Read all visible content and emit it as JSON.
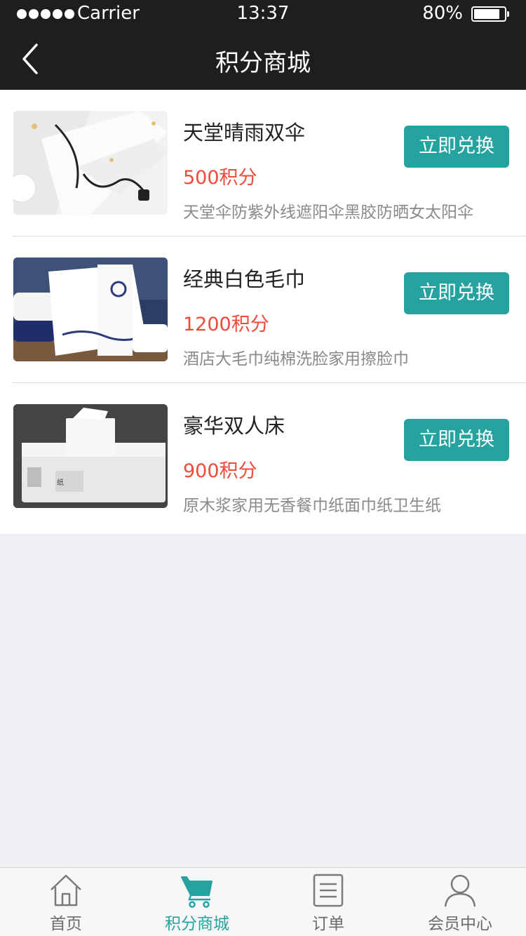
{
  "status_bar": {
    "carrier": "Carrier",
    "time": "13:37",
    "battery": "80%"
  },
  "nav": {
    "title": "积分商城",
    "back_icon": "chevron-left-icon"
  },
  "products": [
    {
      "name": "天堂晴雨双伞",
      "points": "500积分",
      "description": "天堂伞防紫外线遮阳伞黑胶防晒女太阳伞",
      "button": "立即兑换",
      "image": "umbrella-photo"
    },
    {
      "name": "经典白色毛巾",
      "points": "1200积分",
      "description": "酒店大毛巾纯棉洗脸家用擦脸巾",
      "button": "立即兑换",
      "image": "towel-photo"
    },
    {
      "name": "豪华双人床",
      "points": "900积分",
      "description": "原木浆家用无香餐巾纸面巾纸卫生纸",
      "button": "立即兑换",
      "image": "tissue-photo"
    }
  ],
  "tabbar": {
    "items": [
      {
        "label": "首页",
        "icon": "home-icon",
        "active": false
      },
      {
        "label": "积分商城",
        "icon": "cart-icon",
        "active": true
      },
      {
        "label": "订单",
        "icon": "list-icon",
        "active": false
      },
      {
        "label": "会员中心",
        "icon": "user-icon",
        "active": false
      }
    ]
  },
  "colors": {
    "accent": "#26a3a0",
    "price": "#f04b3a",
    "header": "#1e1e21",
    "background": "#efeff4"
  }
}
